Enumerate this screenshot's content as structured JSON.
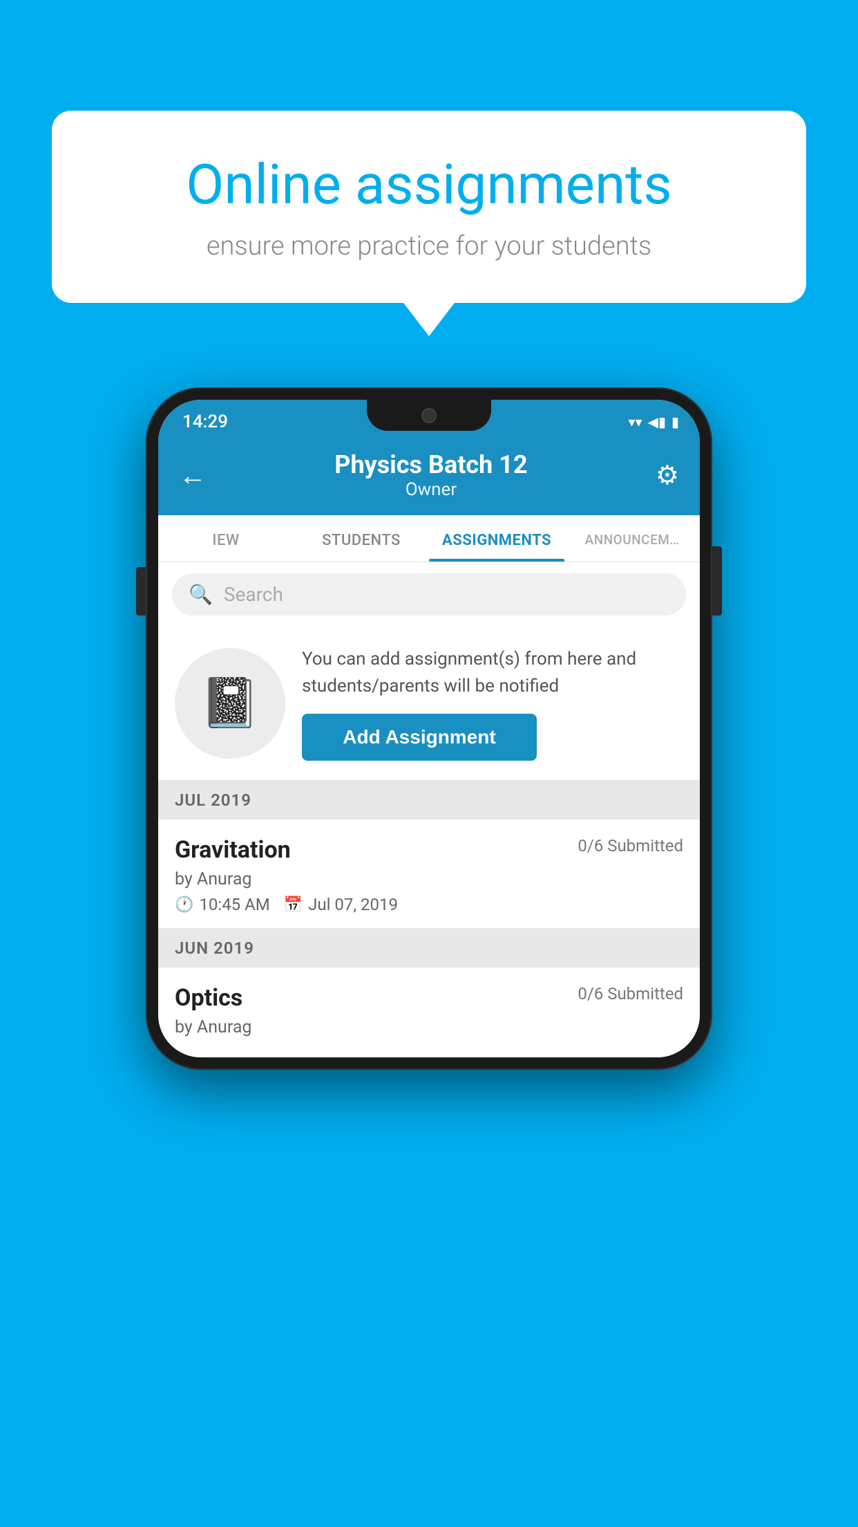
{
  "background_color": "#00AEEF",
  "bubble": {
    "title": "Online assignments",
    "subtitle": "ensure more practice for your students"
  },
  "status_bar": {
    "time": "14:29",
    "wifi": "▾",
    "signal": "◀",
    "battery": "▮"
  },
  "header": {
    "title": "Physics Batch 12",
    "subtitle": "Owner",
    "back_label": "←",
    "gear_label": "⚙"
  },
  "tabs": [
    {
      "label": "IEW",
      "active": false
    },
    {
      "label": "STUDENTS",
      "active": false
    },
    {
      "label": "ASSIGNMENTS",
      "active": true
    },
    {
      "label": "ANNOUNCEM…",
      "active": false
    }
  ],
  "search": {
    "placeholder": "Search"
  },
  "prompt": {
    "text": "You can add assignment(s) from here and students/parents will be notified",
    "button_label": "Add Assignment"
  },
  "sections": [
    {
      "month": "JUL 2019",
      "assignments": [
        {
          "name": "Gravitation",
          "submitted": "0/6 Submitted",
          "by": "by Anurag",
          "time": "10:45 AM",
          "date": "Jul 07, 2019"
        }
      ]
    },
    {
      "month": "JUN 2019",
      "assignments": [
        {
          "name": "Optics",
          "submitted": "0/6 Submitted",
          "by": "by Anurag",
          "time": "",
          "date": ""
        }
      ]
    }
  ]
}
